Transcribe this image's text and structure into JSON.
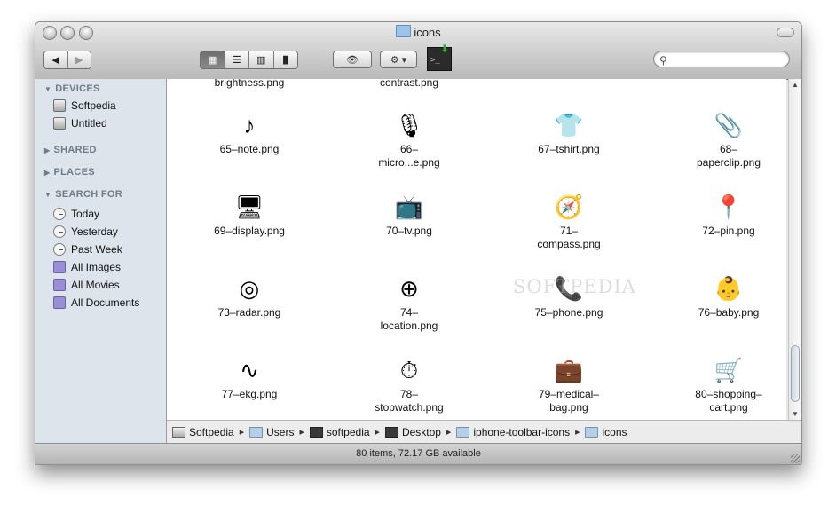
{
  "window": {
    "title": "icons"
  },
  "toolbar": {
    "back_label": "◀",
    "forward_label": "▶",
    "view_icons": [
      "▦",
      "☰",
      "▥",
      "▐▌"
    ],
    "quicklook_label": "👁",
    "action_label": "⚙ ▾",
    "search_placeholder": ""
  },
  "sidebar": {
    "sections": {
      "devices": "DEVICES",
      "shared": "SHARED",
      "places": "PLACES",
      "search_for": "SEARCH FOR"
    },
    "devices": [
      "Softpedia",
      "Untitled"
    ],
    "search_for": [
      "Today",
      "Yesterday",
      "Past Week",
      "All Images",
      "All Movies",
      "All Documents"
    ]
  },
  "files": {
    "partial_top": [
      "brightness.png",
      "contrast.png"
    ],
    "items": [
      {
        "name": "65–note.png",
        "icon": "♪"
      },
      {
        "name": "66–\nmicro...e.png",
        "icon": "🎙"
      },
      {
        "name": "67–tshirt.png",
        "icon": "👕"
      },
      {
        "name": "68–\npaperclip.png",
        "icon": "📎"
      },
      {
        "name": "69–display.png",
        "icon": "🖥"
      },
      {
        "name": "70–tv.png",
        "icon": "📺"
      },
      {
        "name": "71–\ncompass.png",
        "icon": "🧭"
      },
      {
        "name": "72–pin.png",
        "icon": "📍"
      },
      {
        "name": "73–radar.png",
        "icon": "◎"
      },
      {
        "name": "74–\nlocation.png",
        "icon": "⊕"
      },
      {
        "name": "75–phone.png",
        "icon": "📞"
      },
      {
        "name": "76–baby.png",
        "icon": "👶"
      },
      {
        "name": "77–ekg.png",
        "icon": "∿"
      },
      {
        "name": "78–\nstopwatch.png",
        "icon": "⏱"
      },
      {
        "name": "79–medical–\nbag.png",
        "icon": "💼"
      },
      {
        "name": "80–shopping–\ncart.png",
        "icon": "🛒"
      }
    ]
  },
  "pathbar": [
    "Softpedia",
    "Users",
    "softpedia",
    "Desktop",
    "iphone-toolbar-icons",
    "icons"
  ],
  "status": {
    "text": "80 items, 72.17 GB available"
  },
  "watermark": "SOFTPEDIA"
}
